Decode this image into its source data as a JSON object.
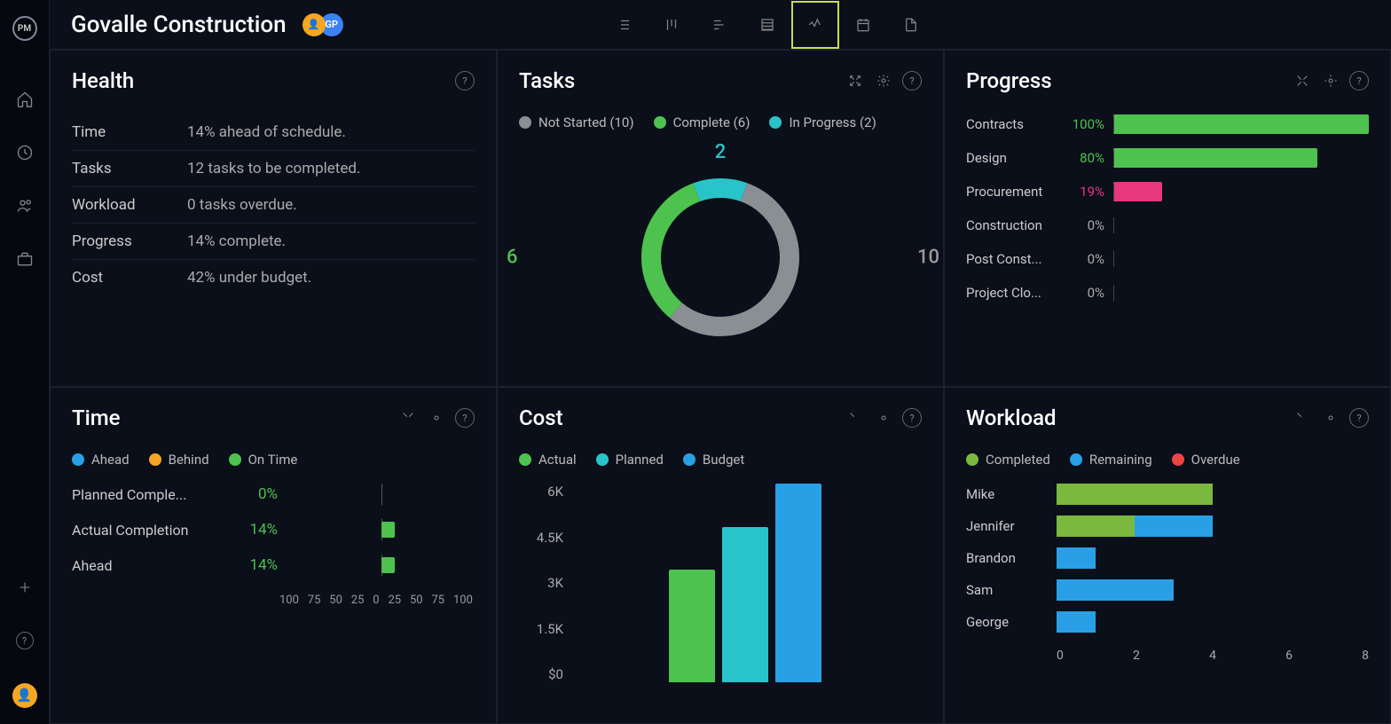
{
  "app": {
    "logo": "PM",
    "title": "Govalle Construction",
    "avatar2": "GP"
  },
  "sidebar_icons": [
    "home",
    "clock",
    "users",
    "briefcase"
  ],
  "sidebar_bottom": [
    "plus",
    "help"
  ],
  "viewtabs": [
    "list",
    "board",
    "gantt",
    "sheet",
    "dashboard",
    "calendar",
    "file"
  ],
  "viewtab_active": 4,
  "panels": {
    "health": {
      "title": "Health",
      "rows": [
        {
          "label": "Time",
          "value": "14% ahead of schedule."
        },
        {
          "label": "Tasks",
          "value": "12 tasks to be completed."
        },
        {
          "label": "Workload",
          "value": "0 tasks overdue."
        },
        {
          "label": "Progress",
          "value": "14% complete."
        },
        {
          "label": "Cost",
          "value": "42% under budget."
        }
      ]
    },
    "tasks": {
      "title": "Tasks",
      "legend": [
        {
          "label": "Not Started (10)",
          "color": "#8a8f94"
        },
        {
          "label": "Complete (6)",
          "color": "#4ec24e"
        },
        {
          "label": "In Progress (2)",
          "color": "#29c4c9"
        }
      ],
      "chart_data": {
        "type": "pie",
        "series": [
          {
            "name": "Not Started",
            "value": 10,
            "color": "#8a8f94"
          },
          {
            "name": "Complete",
            "value": 6,
            "color": "#4ec24e"
          },
          {
            "name": "In Progress",
            "value": 2,
            "color": "#29c4c9"
          }
        ],
        "labels": {
          "not_started": "10",
          "complete": "6",
          "in_progress": "2"
        }
      }
    },
    "progress": {
      "title": "Progress",
      "rows": [
        {
          "label": "Contracts",
          "pct": 100,
          "color": "#4ec24e",
          "pcolor": "#4ec24e"
        },
        {
          "label": "Design",
          "pct": 80,
          "color": "#4ec24e",
          "pcolor": "#4ec24e"
        },
        {
          "label": "Procurement",
          "pct": 19,
          "color": "#e6377f",
          "pcolor": "#e6377f"
        },
        {
          "label": "Construction",
          "pct": 0,
          "color": "#4ec24e",
          "pcolor": "#aaa"
        },
        {
          "label": "Post Const...",
          "pct": 0,
          "color": "#4ec24e",
          "pcolor": "#aaa"
        },
        {
          "label": "Project Clo...",
          "pct": 0,
          "color": "#4ec24e",
          "pcolor": "#aaa"
        }
      ]
    },
    "time": {
      "title": "Time",
      "legend": [
        {
          "label": "Ahead",
          "color": "#29a0e6"
        },
        {
          "label": "Behind",
          "color": "#f5a623"
        },
        {
          "label": "On Time",
          "color": "#4ec24e"
        }
      ],
      "rows": [
        {
          "label": "Planned Comple...",
          "pct": "0%",
          "bar": 0
        },
        {
          "label": "Actual Completion",
          "pct": "14%",
          "bar": 14
        },
        {
          "label": "Ahead",
          "pct": "14%",
          "bar": 14
        }
      ],
      "axis": [
        "100",
        "75",
        "50",
        "25",
        "0",
        "25",
        "50",
        "75",
        "100"
      ]
    },
    "cost": {
      "title": "Cost",
      "legend": [
        {
          "label": "Actual",
          "color": "#4ec24e"
        },
        {
          "label": "Planned",
          "color": "#29c4c9"
        },
        {
          "label": "Budget",
          "color": "#29a0e6"
        }
      ],
      "chart_data": {
        "type": "bar",
        "categories": [
          "Actual",
          "Planned",
          "Budget"
        ],
        "values": [
          3400,
          4700,
          6000
        ],
        "yticks": [
          "$0",
          "1.5K",
          "3K",
          "4.5K",
          "6K"
        ],
        "ylim": [
          0,
          6000
        ],
        "colors": [
          "#4ec24e",
          "#29c4c9",
          "#29a0e6"
        ]
      }
    },
    "workload": {
      "title": "Workload",
      "legend": [
        {
          "label": "Completed",
          "color": "#7bb83f"
        },
        {
          "label": "Remaining",
          "color": "#29a0e6"
        },
        {
          "label": "Overdue",
          "color": "#ef4444"
        }
      ],
      "chart_data": {
        "type": "bar",
        "orientation": "horizontal",
        "xlim": [
          0,
          8
        ],
        "xticks": [
          "0",
          "2",
          "4",
          "6",
          "8"
        ],
        "rows": [
          {
            "name": "Mike",
            "completed": 4,
            "remaining": 0,
            "overdue": 0
          },
          {
            "name": "Jennifer",
            "completed": 2,
            "remaining": 2,
            "overdue": 0
          },
          {
            "name": "Brandon",
            "completed": 0,
            "remaining": 1,
            "overdue": 0
          },
          {
            "name": "Sam",
            "completed": 0,
            "remaining": 3,
            "overdue": 0
          },
          {
            "name": "George",
            "completed": 0,
            "remaining": 1,
            "overdue": 0
          }
        ]
      }
    }
  }
}
